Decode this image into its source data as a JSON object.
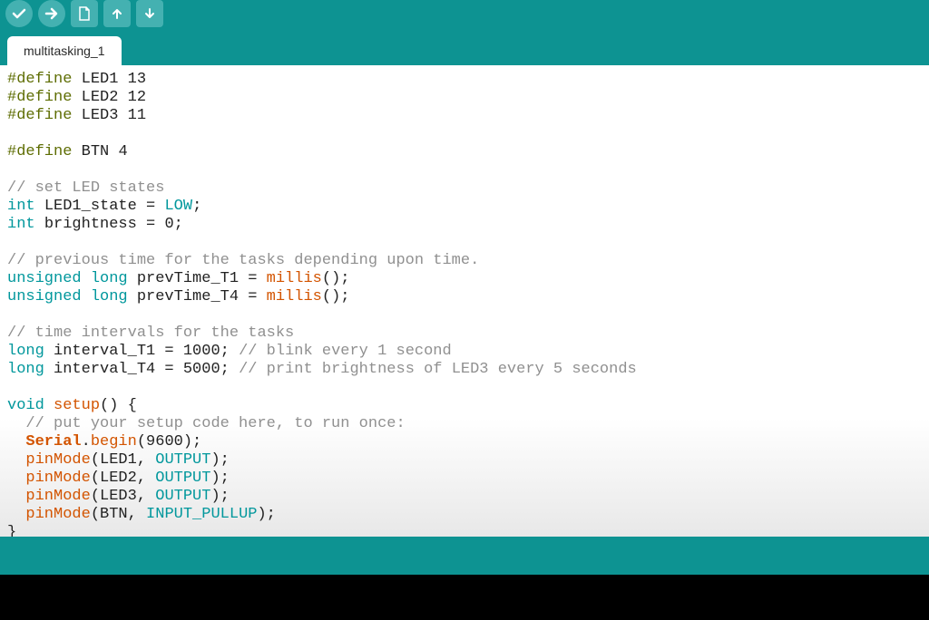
{
  "toolbar": {
    "buttons": [
      "verify",
      "upload",
      "new",
      "open",
      "save"
    ]
  },
  "tabs": {
    "active": "multitasking_1"
  },
  "code": {
    "lines": [
      [
        [
          "define",
          "#define"
        ],
        [
          "sp",
          " "
        ],
        [
          "ident",
          "LED1"
        ],
        [
          "sp",
          " "
        ],
        [
          "lit",
          "13"
        ]
      ],
      [
        [
          "define",
          "#define"
        ],
        [
          "sp",
          " "
        ],
        [
          "ident",
          "LED2"
        ],
        [
          "sp",
          " "
        ],
        [
          "lit",
          "12"
        ]
      ],
      [
        [
          "define",
          "#define"
        ],
        [
          "sp",
          " "
        ],
        [
          "ident",
          "LED3"
        ],
        [
          "sp",
          " "
        ],
        [
          "lit",
          "11"
        ]
      ],
      [],
      [
        [
          "define",
          "#define"
        ],
        [
          "sp",
          " "
        ],
        [
          "ident",
          "BTN"
        ],
        [
          "sp",
          " "
        ],
        [
          "lit",
          "4"
        ]
      ],
      [],
      [
        [
          "comment",
          "// set LED states"
        ]
      ],
      [
        [
          "type",
          "int"
        ],
        [
          "sp",
          " "
        ],
        [
          "ident",
          "LED1_state"
        ],
        [
          "sp",
          " = "
        ],
        [
          "const",
          "LOW"
        ],
        [
          "lit",
          ";"
        ]
      ],
      [
        [
          "type",
          "int"
        ],
        [
          "sp",
          " "
        ],
        [
          "ident",
          "brightness"
        ],
        [
          "sp",
          " = "
        ],
        [
          "lit",
          "0;"
        ]
      ],
      [],
      [
        [
          "comment",
          "// previous time for the tasks depending upon time."
        ]
      ],
      [
        [
          "type",
          "unsigned long"
        ],
        [
          "sp",
          " "
        ],
        [
          "ident",
          "prevTime_T1"
        ],
        [
          "sp",
          " = "
        ],
        [
          "func",
          "millis"
        ],
        [
          "lit",
          "();"
        ]
      ],
      [
        [
          "type",
          "unsigned long"
        ],
        [
          "sp",
          " "
        ],
        [
          "ident",
          "prevTime_T4"
        ],
        [
          "sp",
          " = "
        ],
        [
          "func",
          "millis"
        ],
        [
          "lit",
          "();"
        ]
      ],
      [],
      [
        [
          "comment",
          "// time intervals for the tasks"
        ]
      ],
      [
        [
          "type",
          "long"
        ],
        [
          "sp",
          " "
        ],
        [
          "ident",
          "interval_T1"
        ],
        [
          "sp",
          " = "
        ],
        [
          "lit",
          "1000; "
        ],
        [
          "comment",
          "// blink every 1 second"
        ]
      ],
      [
        [
          "type",
          "long"
        ],
        [
          "sp",
          " "
        ],
        [
          "ident",
          "interval_T4"
        ],
        [
          "sp",
          " = "
        ],
        [
          "lit",
          "5000; "
        ],
        [
          "comment",
          "// print brightness of LED3 every 5 seconds"
        ]
      ],
      [],
      [
        [
          "type",
          "void"
        ],
        [
          "sp",
          " "
        ],
        [
          "func",
          "setup"
        ],
        [
          "lit",
          "() {"
        ]
      ],
      [
        [
          "sp",
          "  "
        ],
        [
          "comment",
          "// put your setup code here, to run once:"
        ]
      ],
      [
        [
          "sp",
          "  "
        ],
        [
          "serial",
          "Serial"
        ],
        [
          "lit",
          "."
        ],
        [
          "func",
          "begin"
        ],
        [
          "lit",
          "(9600);"
        ]
      ],
      [
        [
          "sp",
          "  "
        ],
        [
          "func",
          "pinMode"
        ],
        [
          "lit",
          "(LED1, "
        ],
        [
          "const",
          "OUTPUT"
        ],
        [
          "lit",
          ");"
        ]
      ],
      [
        [
          "sp",
          "  "
        ],
        [
          "func",
          "pinMode"
        ],
        [
          "lit",
          "(LED2, "
        ],
        [
          "const",
          "OUTPUT"
        ],
        [
          "lit",
          ");"
        ]
      ],
      [
        [
          "sp",
          "  "
        ],
        [
          "func",
          "pinMode"
        ],
        [
          "lit",
          "(LED3, "
        ],
        [
          "const",
          "OUTPUT"
        ],
        [
          "lit",
          ");"
        ]
      ],
      [
        [
          "sp",
          "  "
        ],
        [
          "func",
          "pinMode"
        ],
        [
          "lit",
          "(BTN, "
        ],
        [
          "const",
          "INPUT_PULLUP"
        ],
        [
          "lit",
          ");"
        ]
      ],
      [
        [
          "lit",
          "}"
        ]
      ]
    ]
  },
  "colors": {
    "teal": "#0d9392",
    "tealLight": "#44b1b1",
    "define": "#5e6d03",
    "keyword": "#00979c",
    "func": "#d35400",
    "comment": "#909090"
  }
}
